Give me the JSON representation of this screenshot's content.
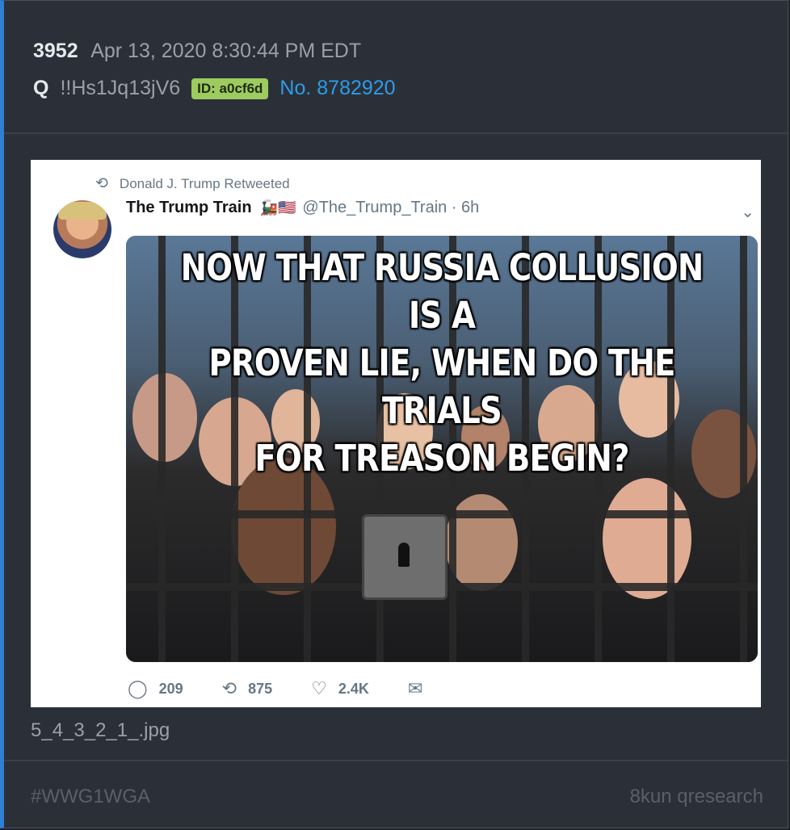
{
  "post": {
    "number": "3952",
    "timestamp": "Apr 13, 2020 8:30:44 PM EDT",
    "author": "Q",
    "tripcode": "!!Hs1Jq13jV6",
    "id_badge": "ID: a0cf6d",
    "post_no": "No. 8782920",
    "accent_color": "#2f7fd4"
  },
  "tweet": {
    "retweet_label": "Donald J. Trump Retweeted",
    "display_name": "The Trump Train",
    "handle_time": "@The_Trump_Train · 6h",
    "meme_text": "NOW THAT RUSSIA COLLUSION IS A\nPROVEN LIE, WHEN DO THE TRIALS\nFOR TREASON BEGIN?",
    "replies": "209",
    "retweets": "875",
    "likes": "2.4K"
  },
  "attachment": {
    "filename": "5_4_3_2_1_.jpg"
  },
  "footer": {
    "hashtag": "#WWG1WGA",
    "source": "8kun qresearch"
  }
}
